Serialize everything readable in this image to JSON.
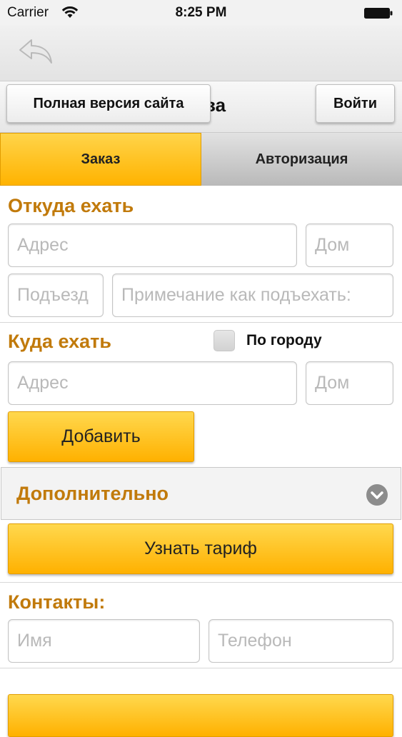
{
  "status_bar": {
    "carrier": "Carrier",
    "time": "8:25 PM"
  },
  "header": {
    "title_fragment": "ва",
    "full_site_label": "Полная версия сайта",
    "login_label": "Войти"
  },
  "tabs": [
    {
      "label": "Заказ",
      "active": true
    },
    {
      "label": "Авторизация",
      "active": false
    }
  ],
  "from": {
    "title": "Откуда ехать",
    "address_placeholder": "Адрес",
    "house_placeholder": "Дом",
    "entrance_placeholder": "Подъезд",
    "note_placeholder": "Примечание как подъехать:"
  },
  "to": {
    "title": "Куда ехать",
    "city_checkbox_label": "По городу",
    "address_placeholder": "Адрес",
    "house_placeholder": "Дом",
    "add_label": "Добавить"
  },
  "extra": {
    "title": "Дополнительно"
  },
  "tariff": {
    "label": "Узнать тариф"
  },
  "contacts": {
    "title": "Контакты:",
    "name_placeholder": "Имя",
    "phone_placeholder": "Телефон"
  },
  "colors": {
    "accent_orange": "#ffb300",
    "section_title": "#c17a0b"
  },
  "icons": {
    "back": "back-arrow-icon",
    "wifi": "wifi-icon",
    "battery": "battery-icon",
    "chevron": "chevron-down-icon"
  }
}
